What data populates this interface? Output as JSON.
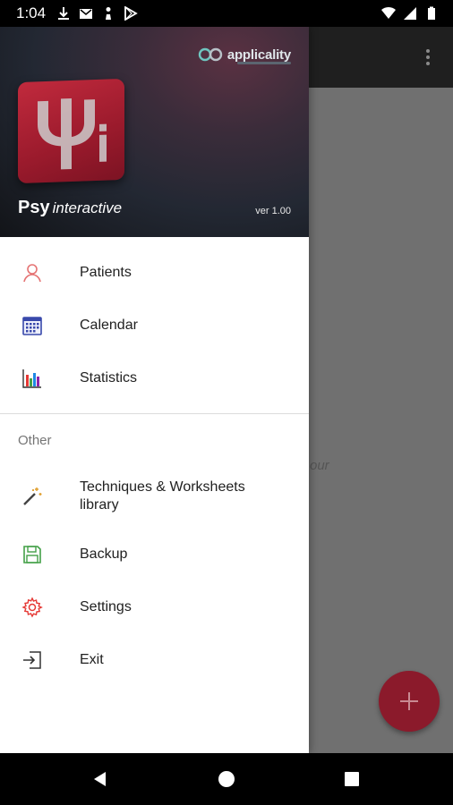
{
  "status_bar": {
    "time": "1:04",
    "left_icons": [
      "download-icon",
      "mail-icon",
      "chess-piece-icon",
      "play-store-icon"
    ],
    "right_icons": [
      "wifi-icon",
      "signal-icon",
      "battery-icon"
    ]
  },
  "drawer": {
    "brand": "applicality",
    "logo_glyph": "Ψi",
    "app_name_bold": "Psy",
    "app_name_italic": "interactive",
    "version": "ver 1.00",
    "main_items": [
      {
        "label": "Patients",
        "icon": "person-icon"
      },
      {
        "label": "Calendar",
        "icon": "calendar-icon"
      },
      {
        "label": "Statistics",
        "icon": "bar-chart-icon"
      }
    ],
    "section_title": "Other",
    "other_items": [
      {
        "label": "Techniques & Worksheets library",
        "icon": "magic-wand-icon"
      },
      {
        "label": "Backup",
        "icon": "floppy-disk-icon"
      },
      {
        "label": "Settings",
        "icon": "gear-icon"
      },
      {
        "label": "Exit",
        "icon": "exit-icon"
      }
    ]
  },
  "background": {
    "partial_text": "our",
    "fab_icon": "plus-icon"
  },
  "colors": {
    "accent": "#b0243a",
    "patients_icon": "#e57373",
    "calendar_icon": "#3949ab",
    "backup_icon": "#43a047",
    "settings_icon": "#e53935"
  }
}
